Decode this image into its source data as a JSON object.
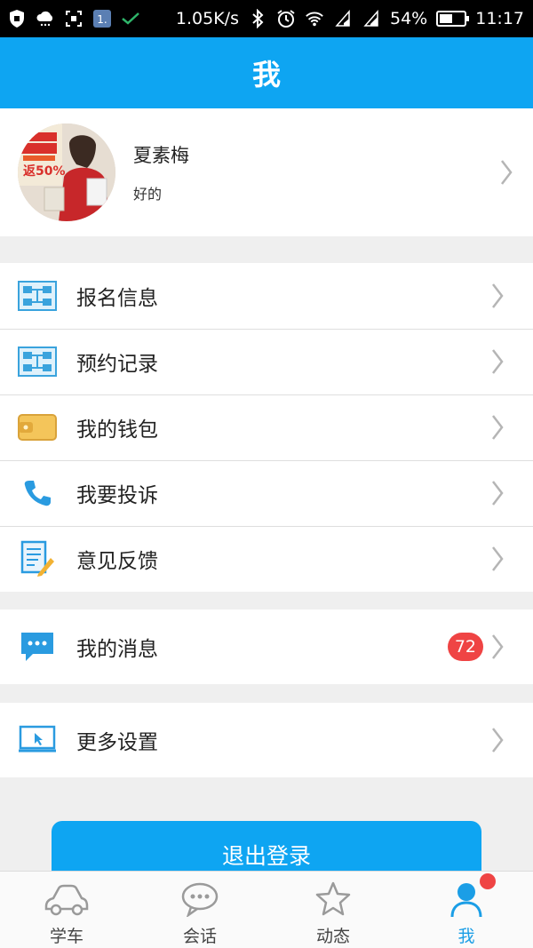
{
  "status_bar": {
    "speed": "1.05K/s",
    "battery": "54%",
    "battery_level": 0.54,
    "time": "11:17"
  },
  "header": {
    "title": "我"
  },
  "profile": {
    "name": "夏素梅",
    "signature": "好的",
    "avatar_text": "返50%"
  },
  "menu_group_1": [
    {
      "label": "报名信息",
      "icon": "registration-icon"
    },
    {
      "label": "预约记录",
      "icon": "appointment-icon"
    },
    {
      "label": "我的钱包",
      "icon": "wallet-icon"
    },
    {
      "label": "我要投诉",
      "icon": "phone-icon"
    },
    {
      "label": "意见反馈",
      "icon": "feedback-icon"
    }
  ],
  "menu_group_2": [
    {
      "label": "我的消息",
      "icon": "message-icon",
      "badge": "72"
    }
  ],
  "menu_group_3": [
    {
      "label": "更多设置",
      "icon": "settings-icon"
    }
  ],
  "logout": {
    "label": "退出登录"
  },
  "tabs": [
    {
      "label": "学车",
      "icon": "car-icon"
    },
    {
      "label": "会话",
      "icon": "chat-icon"
    },
    {
      "label": "动态",
      "icon": "star-icon"
    },
    {
      "label": "我",
      "icon": "person-icon",
      "active": true
    }
  ],
  "colors": {
    "primary": "#0ea5f2",
    "badge": "#ef4444",
    "active_tab": "#1b9ee6"
  }
}
